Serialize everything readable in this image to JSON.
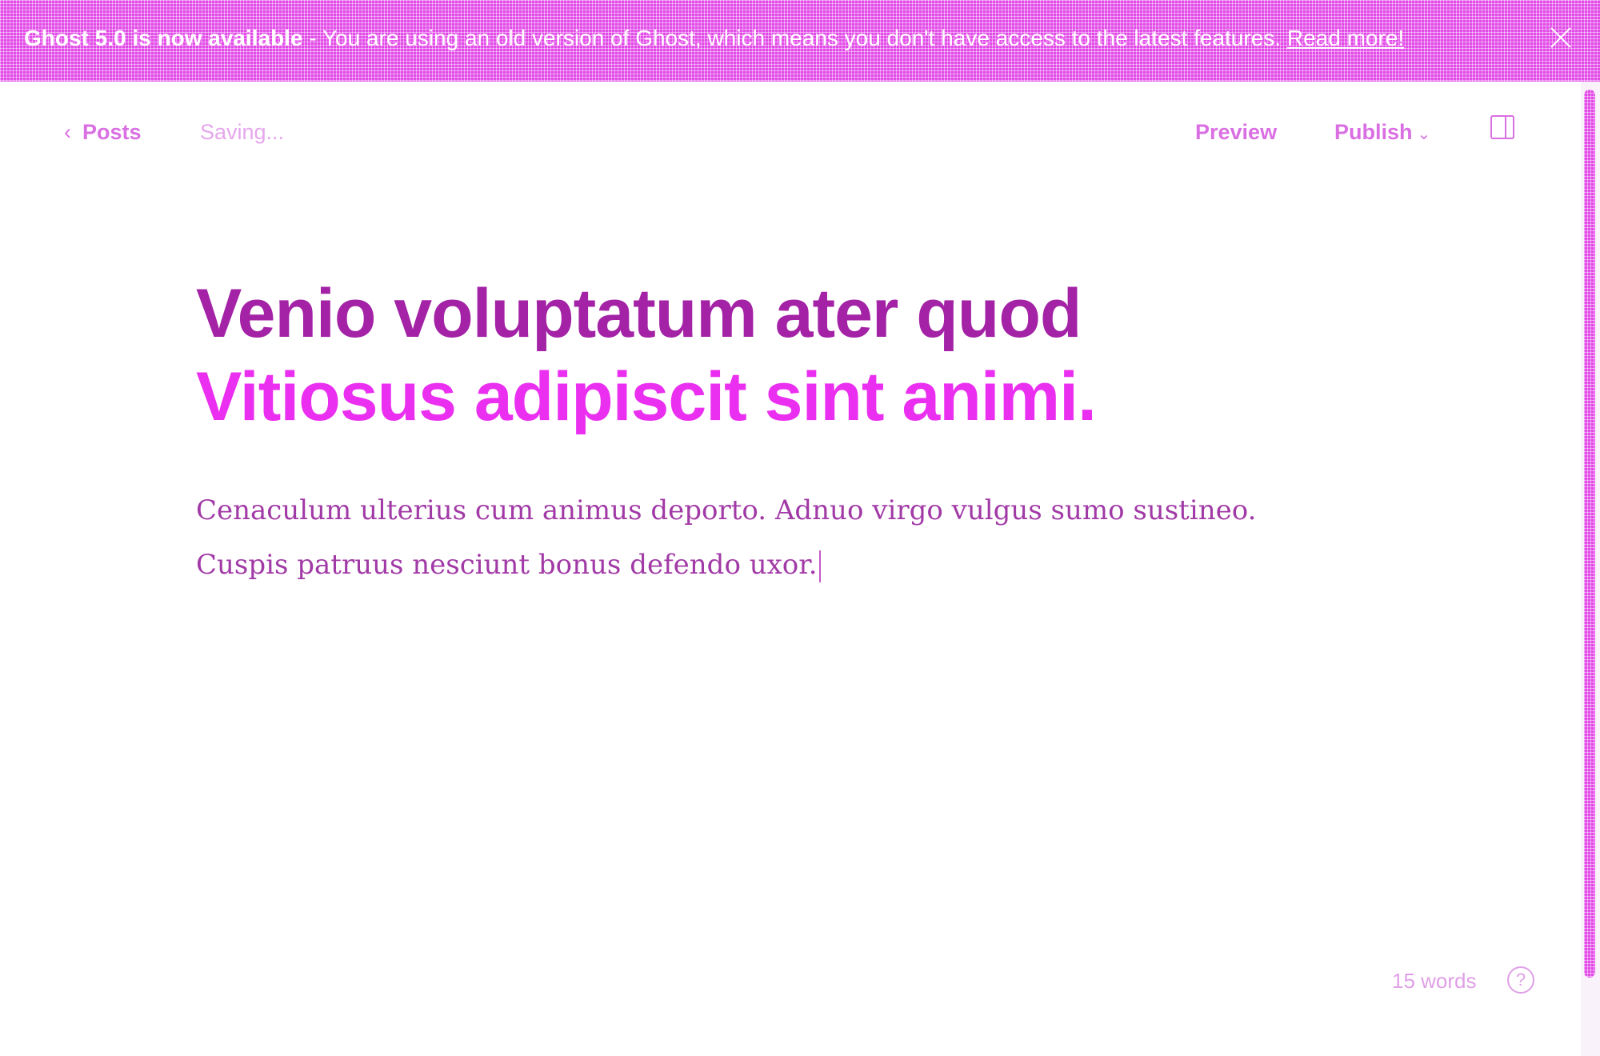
{
  "banner": {
    "title": "Ghost 5.0 is now available",
    "message": " - You are using an old version of Ghost, which means you don't have access to the latest features. ",
    "link": "Read more!",
    "close_icon": "close-icon"
  },
  "toolbar": {
    "back_label": "Posts",
    "back_icon": "chevron-left-icon",
    "status": "Saving...",
    "preview_label": "Preview",
    "publish_label": "Publish",
    "publish_icon": "chevron-down-icon",
    "sidebar_icon": "sidebar-toggle-icon"
  },
  "post": {
    "title_line1": "Venio voluptatum ater quod",
    "title_line2": "Vitiosus adipiscit sint animi.",
    "body_line1": "Cenaculum ulterius cum animus deporto. Adnuo virgo vulgus sumo sustineo.",
    "body_line2": "Cuspis patruus nesciunt bonus defendo uxor."
  },
  "footer": {
    "word_count": "15 words",
    "help_icon": "help-icon",
    "help_glyph": "?"
  },
  "colors": {
    "accent": "#e24ae8",
    "title": "#a322a6",
    "title_highlight": "#ea2ff0",
    "body": "#a13aa6"
  }
}
